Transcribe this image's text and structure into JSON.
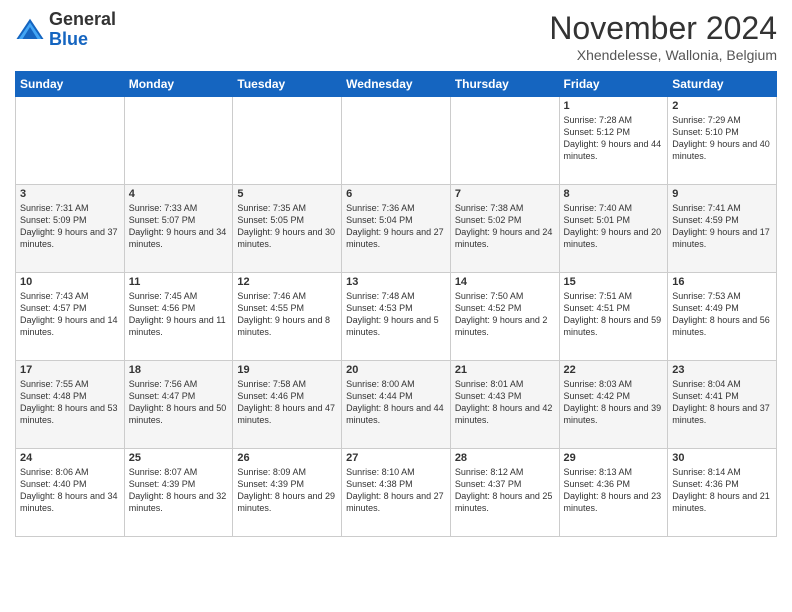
{
  "logo": {
    "general": "General",
    "blue": "Blue"
  },
  "header": {
    "month": "November 2024",
    "location": "Xhendelesse, Wallonia, Belgium"
  },
  "weekdays": [
    "Sunday",
    "Monday",
    "Tuesday",
    "Wednesday",
    "Thursday",
    "Friday",
    "Saturday"
  ],
  "weeks": [
    [
      {
        "day": "",
        "text": ""
      },
      {
        "day": "",
        "text": ""
      },
      {
        "day": "",
        "text": ""
      },
      {
        "day": "",
        "text": ""
      },
      {
        "day": "",
        "text": ""
      },
      {
        "day": "1",
        "text": "Sunrise: 7:28 AM\nSunset: 5:12 PM\nDaylight: 9 hours and 44 minutes."
      },
      {
        "day": "2",
        "text": "Sunrise: 7:29 AM\nSunset: 5:10 PM\nDaylight: 9 hours and 40 minutes."
      }
    ],
    [
      {
        "day": "3",
        "text": "Sunrise: 7:31 AM\nSunset: 5:09 PM\nDaylight: 9 hours and 37 minutes."
      },
      {
        "day": "4",
        "text": "Sunrise: 7:33 AM\nSunset: 5:07 PM\nDaylight: 9 hours and 34 minutes."
      },
      {
        "day": "5",
        "text": "Sunrise: 7:35 AM\nSunset: 5:05 PM\nDaylight: 9 hours and 30 minutes."
      },
      {
        "day": "6",
        "text": "Sunrise: 7:36 AM\nSunset: 5:04 PM\nDaylight: 9 hours and 27 minutes."
      },
      {
        "day": "7",
        "text": "Sunrise: 7:38 AM\nSunset: 5:02 PM\nDaylight: 9 hours and 24 minutes."
      },
      {
        "day": "8",
        "text": "Sunrise: 7:40 AM\nSunset: 5:01 PM\nDaylight: 9 hours and 20 minutes."
      },
      {
        "day": "9",
        "text": "Sunrise: 7:41 AM\nSunset: 4:59 PM\nDaylight: 9 hours and 17 minutes."
      }
    ],
    [
      {
        "day": "10",
        "text": "Sunrise: 7:43 AM\nSunset: 4:57 PM\nDaylight: 9 hours and 14 minutes."
      },
      {
        "day": "11",
        "text": "Sunrise: 7:45 AM\nSunset: 4:56 PM\nDaylight: 9 hours and 11 minutes."
      },
      {
        "day": "12",
        "text": "Sunrise: 7:46 AM\nSunset: 4:55 PM\nDaylight: 9 hours and 8 minutes."
      },
      {
        "day": "13",
        "text": "Sunrise: 7:48 AM\nSunset: 4:53 PM\nDaylight: 9 hours and 5 minutes."
      },
      {
        "day": "14",
        "text": "Sunrise: 7:50 AM\nSunset: 4:52 PM\nDaylight: 9 hours and 2 minutes."
      },
      {
        "day": "15",
        "text": "Sunrise: 7:51 AM\nSunset: 4:51 PM\nDaylight: 8 hours and 59 minutes."
      },
      {
        "day": "16",
        "text": "Sunrise: 7:53 AM\nSunset: 4:49 PM\nDaylight: 8 hours and 56 minutes."
      }
    ],
    [
      {
        "day": "17",
        "text": "Sunrise: 7:55 AM\nSunset: 4:48 PM\nDaylight: 8 hours and 53 minutes."
      },
      {
        "day": "18",
        "text": "Sunrise: 7:56 AM\nSunset: 4:47 PM\nDaylight: 8 hours and 50 minutes."
      },
      {
        "day": "19",
        "text": "Sunrise: 7:58 AM\nSunset: 4:46 PM\nDaylight: 8 hours and 47 minutes."
      },
      {
        "day": "20",
        "text": "Sunrise: 8:00 AM\nSunset: 4:44 PM\nDaylight: 8 hours and 44 minutes."
      },
      {
        "day": "21",
        "text": "Sunrise: 8:01 AM\nSunset: 4:43 PM\nDaylight: 8 hours and 42 minutes."
      },
      {
        "day": "22",
        "text": "Sunrise: 8:03 AM\nSunset: 4:42 PM\nDaylight: 8 hours and 39 minutes."
      },
      {
        "day": "23",
        "text": "Sunrise: 8:04 AM\nSunset: 4:41 PM\nDaylight: 8 hours and 37 minutes."
      }
    ],
    [
      {
        "day": "24",
        "text": "Sunrise: 8:06 AM\nSunset: 4:40 PM\nDaylight: 8 hours and 34 minutes."
      },
      {
        "day": "25",
        "text": "Sunrise: 8:07 AM\nSunset: 4:39 PM\nDaylight: 8 hours and 32 minutes."
      },
      {
        "day": "26",
        "text": "Sunrise: 8:09 AM\nSunset: 4:39 PM\nDaylight: 8 hours and 29 minutes."
      },
      {
        "day": "27",
        "text": "Sunrise: 8:10 AM\nSunset: 4:38 PM\nDaylight: 8 hours and 27 minutes."
      },
      {
        "day": "28",
        "text": "Sunrise: 8:12 AM\nSunset: 4:37 PM\nDaylight: 8 hours and 25 minutes."
      },
      {
        "day": "29",
        "text": "Sunrise: 8:13 AM\nSunset: 4:36 PM\nDaylight: 8 hours and 23 minutes."
      },
      {
        "day": "30",
        "text": "Sunrise: 8:14 AM\nSunset: 4:36 PM\nDaylight: 8 hours and 21 minutes."
      }
    ]
  ]
}
